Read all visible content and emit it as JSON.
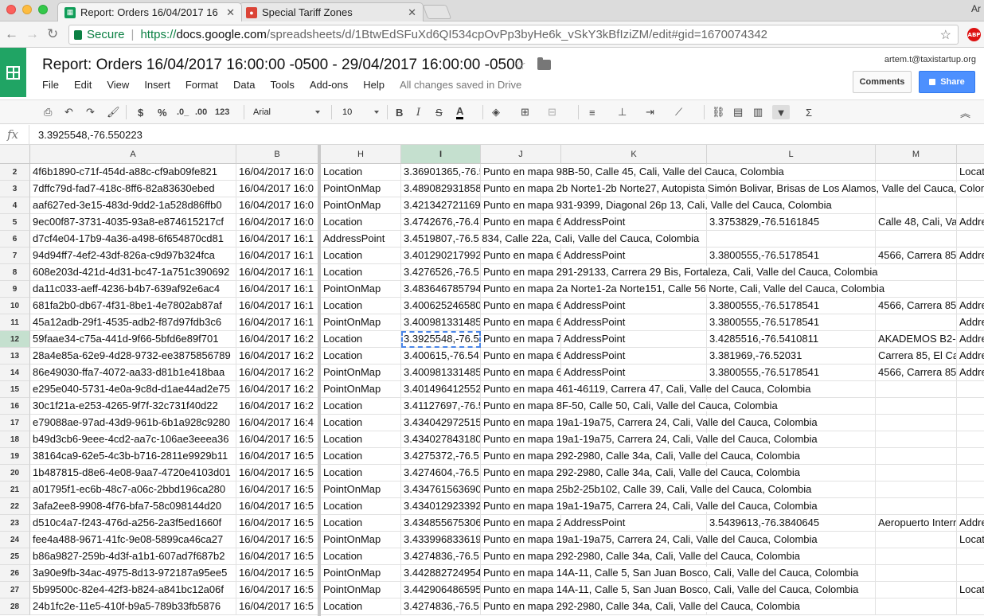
{
  "browser": {
    "tabs": [
      {
        "title": "Report: Orders 16/04/2017 16",
        "active": true,
        "favicon_color": "#0f9d58"
      },
      {
        "title": "Special Tariff Zones",
        "active": false,
        "favicon_color": "#db4437"
      }
    ],
    "profile": "Ar",
    "secure_label": "Secure",
    "url_scheme": "https://",
    "url_host": "docs.google.com",
    "url_path": "/spreadsheets/d/1BtwEdSFuXd6QI534cpOvPp3byHe6k_vSkY3kBfIziZM/edit#gid=1670074342",
    "extension": "ABP"
  },
  "doc": {
    "title": "Report: Orders 16/04/2017 16:00:00 -0500 - 29/04/2017 16:00:00 -0500",
    "menu": [
      "File",
      "Edit",
      "View",
      "Insert",
      "Format",
      "Data",
      "Tools",
      "Add-ons",
      "Help"
    ],
    "save_status": "All changes saved in Drive",
    "user_email": "artem.t@taxistartup.org",
    "comments_label": "Comments",
    "share_label": "Share"
  },
  "toolbar": {
    "currency": "$",
    "percent": "%",
    "decimal_less": ".0_",
    "decimal_more": ".00",
    "more_formats": "123",
    "font": "Arial",
    "font_size": "10",
    "bold": "B",
    "italic": "I",
    "strike": "S",
    "text_color": "A"
  },
  "formula_bar": {
    "fx": "fx",
    "value": "3.3925548,-76.550223"
  },
  "sheet": {
    "columns": [
      "A",
      "B",
      "H",
      "I",
      "J",
      "K",
      "L",
      "M"
    ],
    "selected_column": "I",
    "selected_row": "12",
    "rows": [
      {
        "n": "2",
        "a": "4f6b1890-c71f-454d-a88c-cf9ab09fe821",
        "b": "16/04/2017 16:0",
        "h": "Location",
        "i": "3.36901365,-76.5",
        "j": "Punto en mapa 98B-50, Calle 45, Cali, Valle del Cauca, Colombia",
        "k": "",
        "l": "",
        "m": "",
        "n2": "Locat"
      },
      {
        "n": "3",
        "a": "7dffc79d-fad7-418c-8ff6-82a83630ebed",
        "b": "16/04/2017 16:0",
        "h": "PointOnMap",
        "i": "3.489082931858",
        "j": "Punto en mapa 2b Norte1-2b Norte27, Autopista Simón Bolivar, Brisas de Los Alamos, Valle del Cauca, Colom",
        "k": "",
        "l": "",
        "m": "",
        "n2": ""
      },
      {
        "n": "4",
        "a": "aaf627ed-3e15-483d-9dd2-1a528d86ffb0",
        "b": "16/04/2017 16:0",
        "h": "PointOnMap",
        "i": "3.421342721169",
        "j": "Punto en mapa 931-9399, Diagonal 26p 13, Cali, Valle del Cauca, Colombia",
        "k": "",
        "l": "",
        "m": "",
        "n2": ""
      },
      {
        "n": "5",
        "a": "9ec00f87-3731-4035-93a8-e874615217cf",
        "b": "16/04/2017 16:0",
        "h": "Location",
        "i": "3.4742676,-76.4",
        "j": "Punto en mapa 6",
        "k": "AddressPoint",
        "l": "3.3753829,-76.5161845",
        "m": "Calle 48, Cali, Va",
        "n2": "Addre"
      },
      {
        "n": "6",
        "a": "d7cf4e04-17b9-4a36-a498-6f654870cd81",
        "b": "16/04/2017 16:1",
        "h": "AddressPoint",
        "i": "3.4519807,-76.5 834, Calle 22a, Cali, Valle del Cauca, Colombia",
        "j": "",
        "k": "",
        "l": "",
        "m": "",
        "n2": ""
      },
      {
        "n": "7",
        "a": "94d94ff7-4ef2-43df-826a-c9d97b324fca",
        "b": "16/04/2017 16:1",
        "h": "Location",
        "i": "3.401290217992",
        "j": "Punto en mapa 6",
        "k": "AddressPoint",
        "l": "3.3800555,-76.5178541",
        "m": "4566, Carrera 85",
        "n2": "Addre"
      },
      {
        "n": "8",
        "a": "608e203d-421d-4d31-bc47-1a751c390692",
        "b": "16/04/2017 16:1",
        "h": "Location",
        "i": "3.4276526,-76.5",
        "j": "Punto en mapa 291-29133, Carrera 29 Bis, Fortaleza, Cali, Valle del Cauca, Colombia",
        "k": "",
        "l": "",
        "m": "",
        "n2": ""
      },
      {
        "n": "9",
        "a": "da11c033-aeff-4236-b4b7-639af92e6ac4",
        "b": "16/04/2017 16:1",
        "h": "PointOnMap",
        "i": "3.483646785794",
        "j": "Punto en mapa 2a Norte1-2a Norte151, Calle 56 Norte, Cali, Valle del Cauca, Colombia",
        "k": "",
        "l": "",
        "m": "",
        "n2": ""
      },
      {
        "n": "10",
        "a": "681fa2b0-db67-4f31-8be1-4e7802ab87af",
        "b": "16/04/2017 16:1",
        "h": "Location",
        "i": "3.400625246580",
        "j": "Punto en mapa 6",
        "k": "AddressPoint",
        "l": "3.3800555,-76.5178541",
        "m": "4566, Carrera 85",
        "n2": "Addre"
      },
      {
        "n": "11",
        "a": "45a12adb-29f1-4535-adb2-f87d97fdb3c6",
        "b": "16/04/2017 16:1",
        "h": "PointOnMap",
        "i": "3.400981331485",
        "j": "Punto en mapa 6",
        "k": "AddressPoint",
        "l": "3.3800555,-76.5178541",
        "m": "",
        "n2": "Addre"
      },
      {
        "n": "12",
        "a": "59faae34-c75a-441d-9f66-5bfd6e89f701",
        "b": "16/04/2017 16:2",
        "h": "Location",
        "i": "3.3925548,-76.5",
        "j": "Punto en mapa 7",
        "k": "AddressPoint",
        "l": "3.4285516,-76.5410811",
        "m": "AKADEMOS B2-",
        "n2": "Addre"
      },
      {
        "n": "13",
        "a": "28a4e85a-62e9-4d28-9732-ee3875856789",
        "b": "16/04/2017 16:2",
        "h": "Location",
        "i": "3.400615,-76.54",
        "j": "Punto en mapa 6",
        "k": "AddressPoint",
        "l": "3.381969,-76.52031",
        "m": "Carrera 85, El Ca",
        "n2": "Addre"
      },
      {
        "n": "14",
        "a": "86e49030-ffa7-4072-aa33-d81b1e418baa",
        "b": "16/04/2017 16:2",
        "h": "PointOnMap",
        "i": "3.400981331485",
        "j": "Punto en mapa 6",
        "k": "AddressPoint",
        "l": "3.3800555,-76.5178541",
        "m": "4566, Carrera 85",
        "n2": "Addre"
      },
      {
        "n": "15",
        "a": "e295e040-5731-4e0a-9c8d-d1ae44ad2e75",
        "b": "16/04/2017 16:2",
        "h": "PointOnMap",
        "i": "3.401496412552",
        "j": "Punto en mapa 461-46119, Carrera 47, Cali, Valle del Cauca, Colombia",
        "k": "",
        "l": "",
        "m": "",
        "n2": ""
      },
      {
        "n": "16",
        "a": "30c1f21a-e253-4265-9f7f-32c731f40d22",
        "b": "16/04/2017 16:2",
        "h": "Location",
        "i": "3.41127697,-76.5",
        "j": "Punto en mapa 8F-50, Calle 50, Cali, Valle del Cauca, Colombia",
        "k": "",
        "l": "",
        "m": "",
        "n2": ""
      },
      {
        "n": "17",
        "a": "e79088ae-97ad-43d9-961b-6b1a928c9280",
        "b": "16/04/2017 16:4",
        "h": "Location",
        "i": "3.434042972515",
        "j": "Punto en mapa 19a1-19a75, Carrera 24, Cali, Valle del Cauca, Colombia",
        "k": "",
        "l": "",
        "m": "",
        "n2": ""
      },
      {
        "n": "18",
        "a": "b49d3cb6-9eee-4cd2-aa7c-106ae3eeea36",
        "b": "16/04/2017 16:5",
        "h": "Location",
        "i": "3.434027843180",
        "j": "Punto en mapa 19a1-19a75, Carrera 24, Cali, Valle del Cauca, Colombia",
        "k": "",
        "l": "",
        "m": "",
        "n2": ""
      },
      {
        "n": "19",
        "a": "38164ca9-62e5-4c3b-b716-2811e9929b11",
        "b": "16/04/2017 16:5",
        "h": "Location",
        "i": "3.4275372,-76.5",
        "j": "Punto en mapa 292-2980, Calle 34a, Cali, Valle del Cauca, Colombia",
        "k": "",
        "l": "",
        "m": "",
        "n2": ""
      },
      {
        "n": "20",
        "a": "1b487815-d8e6-4e08-9aa7-4720e4103d01",
        "b": "16/04/2017 16:5",
        "h": "Location",
        "i": "3.4274604,-76.5",
        "j": "Punto en mapa 292-2980, Calle 34a, Cali, Valle del Cauca, Colombia",
        "k": "",
        "l": "",
        "m": "",
        "n2": ""
      },
      {
        "n": "21",
        "a": "a01795f1-ec6b-48c7-a06c-2bbd196ca280",
        "b": "16/04/2017 16:5",
        "h": "PointOnMap",
        "i": "3.434761563690",
        "j": "Punto en mapa 25b2-25b102, Calle 39, Cali, Valle del Cauca, Colombia",
        "k": "",
        "l": "",
        "m": "",
        "n2": ""
      },
      {
        "n": "22",
        "a": "3afa2ee8-9908-4f76-bfa7-58c098144d20",
        "b": "16/04/2017 16:5",
        "h": "Location",
        "i": "3.434012923392",
        "j": "Punto en mapa 19a1-19a75, Carrera 24, Cali, Valle del Cauca, Colombia",
        "k": "",
        "l": "",
        "m": "",
        "n2": ""
      },
      {
        "n": "23",
        "a": "d510c4a7-f243-476d-a256-2a3f5ed1660f",
        "b": "16/04/2017 16:5",
        "h": "Location",
        "i": "3.434855675306",
        "j": "Punto en mapa 2",
        "k": "AddressPoint",
        "l": "3.5439613,-76.3840645",
        "m": "Aeropuerto Interr",
        "n2": "Addre"
      },
      {
        "n": "24",
        "a": "fee4a488-9671-41fc-9e08-5899ca46ca27",
        "b": "16/04/2017 16:5",
        "h": "PointOnMap",
        "i": "3.433996833619",
        "j": "Punto en mapa 19a1-19a75, Carrera 24, Cali, Valle del Cauca, Colombia",
        "k": "",
        "l": "",
        "m": "",
        "n2": "Locat"
      },
      {
        "n": "25",
        "a": "b86a9827-259b-4d3f-a1b1-607ad7f687b2",
        "b": "16/04/2017 16:5",
        "h": "Location",
        "i": "3.4274836,-76.5",
        "j": "Punto en mapa 292-2980, Calle 34a, Cali, Valle del Cauca, Colombia",
        "k": "",
        "l": "",
        "m": "",
        "n2": ""
      },
      {
        "n": "26",
        "a": "3a90e9fb-34ac-4975-8d13-972187a95ee5",
        "b": "16/04/2017 16:5",
        "h": "PointOnMap",
        "i": "3.442882724954",
        "j": "Punto en mapa 14A-11, Calle 5, San Juan Bosco, Cali, Valle del Cauca, Colombia",
        "k": "",
        "l": "",
        "m": "",
        "n2": ""
      },
      {
        "n": "27",
        "a": "5b99500c-82e4-42f3-b824-a841bc12a06f",
        "b": "16/04/2017 16:5",
        "h": "PointOnMap",
        "i": "3.442906486595",
        "j": "Punto en mapa 14A-11, Calle 5, San Juan Bosco, Cali, Valle del Cauca, Colombia",
        "k": "",
        "l": "",
        "m": "",
        "n2": "Locat"
      },
      {
        "n": "28",
        "a": "24b1fc2e-11e5-410f-b9a5-789b33fb5876",
        "b": "16/04/2017 16:5",
        "h": "Location",
        "i": "3.4274836,-76.5",
        "j": "Punto en mapa 292-2980, Calle 34a, Cali, Valle del Cauca, Colombia",
        "k": "",
        "l": "",
        "m": "",
        "n2": ""
      }
    ]
  }
}
